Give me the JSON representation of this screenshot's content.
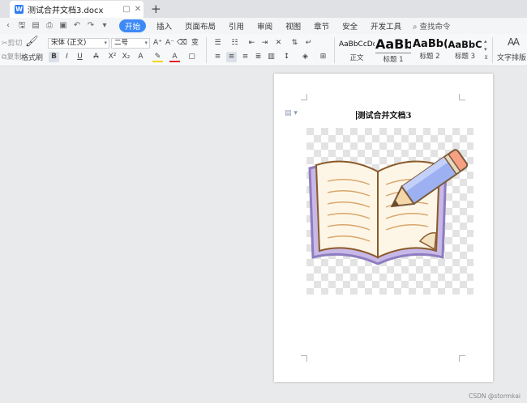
{
  "tab": {
    "title": "测试合并文档3.docx",
    "app_letter": "W"
  },
  "menu": {
    "items": [
      "开始",
      "插入",
      "页面布局",
      "引用",
      "审阅",
      "视图",
      "章节",
      "安全",
      "开发工具"
    ],
    "active_index": 0,
    "search": "查找命令"
  },
  "ribbon": {
    "cut": "剪切",
    "copy": "复制",
    "format_painter": "格式刷",
    "font_name": "宋体 (正文)",
    "font_size": "二号",
    "styles": [
      {
        "sample": "AaBbCcDd",
        "label": "正文"
      },
      {
        "sample": "AaBb",
        "label": "标题 1"
      },
      {
        "sample": "AaBb(",
        "label": "标题 2"
      },
      {
        "sample": "AaBbC",
        "label": "标题 3"
      }
    ],
    "text_layout": "文字排版"
  },
  "document": {
    "title": "测试合并文档3"
  },
  "watermark": "CSDN @stormkai",
  "colors": {
    "accent": "#3d8af7",
    "word_blue": "#2d7bf4"
  }
}
